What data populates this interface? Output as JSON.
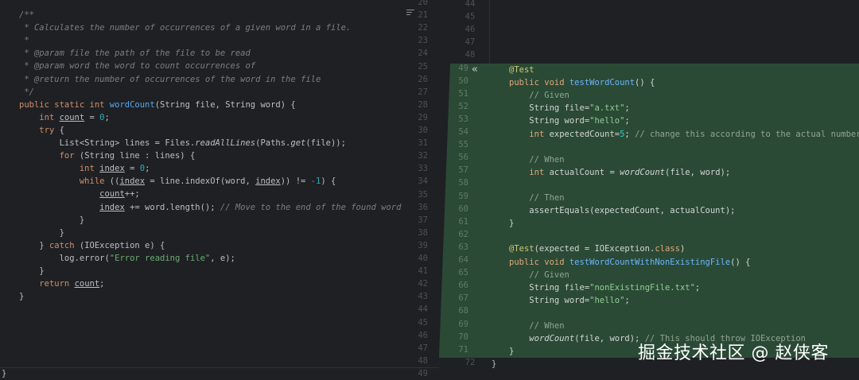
{
  "left": {
    "line_numbers": [
      "20",
      "21",
      "22",
      "23",
      "24",
      "25",
      "26",
      "27",
      "28",
      "29",
      "30",
      "31",
      "32",
      "33",
      "34",
      "35",
      "36",
      "37",
      "38",
      "39",
      "40",
      "41",
      "42",
      "43",
      "44",
      "45",
      "46",
      "47",
      "48",
      "49"
    ],
    "closing_brace": "}",
    "lines": [
      [
        [
          "c",
          "/**"
        ]
      ],
      [
        [
          "c",
          " * Calculates the number of occurrences of a given word in a file."
        ]
      ],
      [
        [
          "c",
          " *"
        ]
      ],
      [
        [
          "c",
          " * "
        ],
        [
          "c",
          "@param"
        ],
        [
          "c",
          " "
        ],
        [
          "c",
          "file"
        ],
        [
          "c",
          " the path of the file to be read"
        ]
      ],
      [
        [
          "c",
          " * "
        ],
        [
          "c",
          "@param"
        ],
        [
          "c",
          " "
        ],
        [
          "c",
          "word"
        ],
        [
          "c",
          " the word to count occurrences of"
        ]
      ],
      [
        [
          "c",
          " * "
        ],
        [
          "c",
          "@return"
        ],
        [
          "c",
          " the number of occurrences of the word in the file"
        ]
      ],
      [
        [
          "c",
          " */"
        ]
      ],
      [
        [
          "k",
          "public static int "
        ],
        [
          "m",
          "wordCount"
        ],
        [
          "t",
          "(String file, String word) {"
        ]
      ],
      [
        [
          "t",
          "    "
        ],
        [
          "k",
          "int "
        ],
        [
          "u",
          "count"
        ],
        [
          "t",
          " = "
        ],
        [
          "n",
          "0"
        ],
        [
          "t",
          ";"
        ]
      ],
      [
        [
          "t",
          "    "
        ],
        [
          "k",
          "try"
        ],
        [
          "t",
          " {"
        ]
      ],
      [
        [
          "t",
          "        List<String> lines = Files."
        ],
        [
          "st",
          "readAllLines"
        ],
        [
          "t",
          "(Paths."
        ],
        [
          "st",
          "get"
        ],
        [
          "t",
          "(file));"
        ]
      ],
      [
        [
          "t",
          "        "
        ],
        [
          "k",
          "for"
        ],
        [
          "t",
          " (String line : lines) {"
        ]
      ],
      [
        [
          "t",
          "            "
        ],
        [
          "k",
          "int "
        ],
        [
          "u",
          "index"
        ],
        [
          "t",
          " = "
        ],
        [
          "n",
          "0"
        ],
        [
          "t",
          ";"
        ]
      ],
      [
        [
          "t",
          "            "
        ],
        [
          "k",
          "while"
        ],
        [
          "t",
          " (("
        ],
        [
          "u",
          "index"
        ],
        [
          "t",
          " = line.indexOf(word, "
        ],
        [
          "u",
          "index"
        ],
        [
          "t",
          ")) != "
        ],
        [
          "n",
          "-1"
        ],
        [
          "t",
          ") {"
        ]
      ],
      [
        [
          "t",
          "                "
        ],
        [
          "u",
          "count"
        ],
        [
          "t",
          "++;"
        ]
      ],
      [
        [
          "t",
          "                "
        ],
        [
          "u",
          "index"
        ],
        [
          "t",
          " += word.length(); "
        ],
        [
          "c",
          "// Move to the end of the found word"
        ]
      ],
      [
        [
          "t",
          "            }"
        ]
      ],
      [
        [
          "t",
          "        }"
        ]
      ],
      [
        [
          "t",
          "    } "
        ],
        [
          "k",
          "catch"
        ],
        [
          "t",
          " (IOException e) {"
        ]
      ],
      [
        [
          "t",
          "        log.error("
        ],
        [
          "s",
          "\"Error reading file\""
        ],
        [
          "t",
          ", e);"
        ]
      ],
      [
        [
          "t",
          "    }"
        ]
      ],
      [
        [
          "t",
          "    "
        ],
        [
          "k",
          "return "
        ],
        [
          "u",
          "count"
        ],
        [
          "t",
          ";"
        ]
      ],
      [
        [
          "t",
          "}"
        ]
      ]
    ]
  },
  "right": {
    "line_numbers": [
      "44",
      "45",
      "46",
      "47",
      "48",
      "49",
      "50",
      "51",
      "52",
      "53",
      "54",
      "55",
      "56",
      "57",
      "58",
      "59",
      "60",
      "61",
      "62",
      "63",
      "64",
      "65",
      "66",
      "67",
      "68",
      "69",
      "70",
      "71",
      "72"
    ],
    "lines": [
      [
        [
          "a",
          "@Test"
        ]
      ],
      [
        [
          "k",
          "public void "
        ],
        [
          "m",
          "testWordCount"
        ],
        [
          "t",
          "() {"
        ]
      ],
      [
        [
          "t",
          "    "
        ],
        [
          "c",
          "// Given"
        ]
      ],
      [
        [
          "t",
          "    String file="
        ],
        [
          "s",
          "\"a.txt\""
        ],
        [
          "t",
          ";"
        ]
      ],
      [
        [
          "t",
          "    String word="
        ],
        [
          "s",
          "\"hello\""
        ],
        [
          "t",
          ";"
        ]
      ],
      [
        [
          "t",
          "    "
        ],
        [
          "k",
          "int"
        ],
        [
          "t",
          " expectedCount="
        ],
        [
          "n",
          "5"
        ],
        [
          "t",
          "; "
        ],
        [
          "c",
          "// change this according to the actual number of 'he"
        ]
      ],
      [
        [
          "t",
          ""
        ]
      ],
      [
        [
          "t",
          "    "
        ],
        [
          "c",
          "// When"
        ]
      ],
      [
        [
          "t",
          "    "
        ],
        [
          "k",
          "int"
        ],
        [
          "t",
          " actualCount = "
        ],
        [
          "st",
          "wordCount"
        ],
        [
          "t",
          "(file, word);"
        ]
      ],
      [
        [
          "t",
          ""
        ]
      ],
      [
        [
          "t",
          "    "
        ],
        [
          "c",
          "// Then"
        ]
      ],
      [
        [
          "t",
          "    assertEquals(expectedCount, actualCount);"
        ]
      ],
      [
        [
          "t",
          "}"
        ]
      ],
      [
        [
          "t",
          ""
        ]
      ],
      [
        [
          "a",
          "@Test"
        ],
        [
          "t",
          "(expected = IOException."
        ],
        [
          "k",
          "class"
        ],
        [
          "t",
          ")"
        ]
      ],
      [
        [
          "k",
          "public void "
        ],
        [
          "m",
          "testWordCountWithNonExistingFile"
        ],
        [
          "t",
          "() {"
        ]
      ],
      [
        [
          "t",
          "    "
        ],
        [
          "c",
          "// Given"
        ]
      ],
      [
        [
          "t",
          "    String file="
        ],
        [
          "s",
          "\"nonExistingFile.txt\""
        ],
        [
          "t",
          ";"
        ]
      ],
      [
        [
          "t",
          "    String word="
        ],
        [
          "s",
          "\"hello\""
        ],
        [
          "t",
          ";"
        ]
      ],
      [
        [
          "t",
          ""
        ]
      ],
      [
        [
          "t",
          "    "
        ],
        [
          "c",
          "// When"
        ]
      ],
      [
        [
          "t",
          "    "
        ],
        [
          "st",
          "wordCount"
        ],
        [
          "t",
          "(file, word); "
        ],
        [
          "c",
          "// This should throw IOException"
        ]
      ],
      [
        [
          "t",
          "}"
        ]
      ]
    ],
    "last_line": "}",
    "collapse_icon": "chevron-double-left-icon"
  },
  "colors": {
    "diff_background": "#2b4a35",
    "editor_background": "#1f2023"
  },
  "watermark": "掘金技术社区 @ 赵侠客"
}
